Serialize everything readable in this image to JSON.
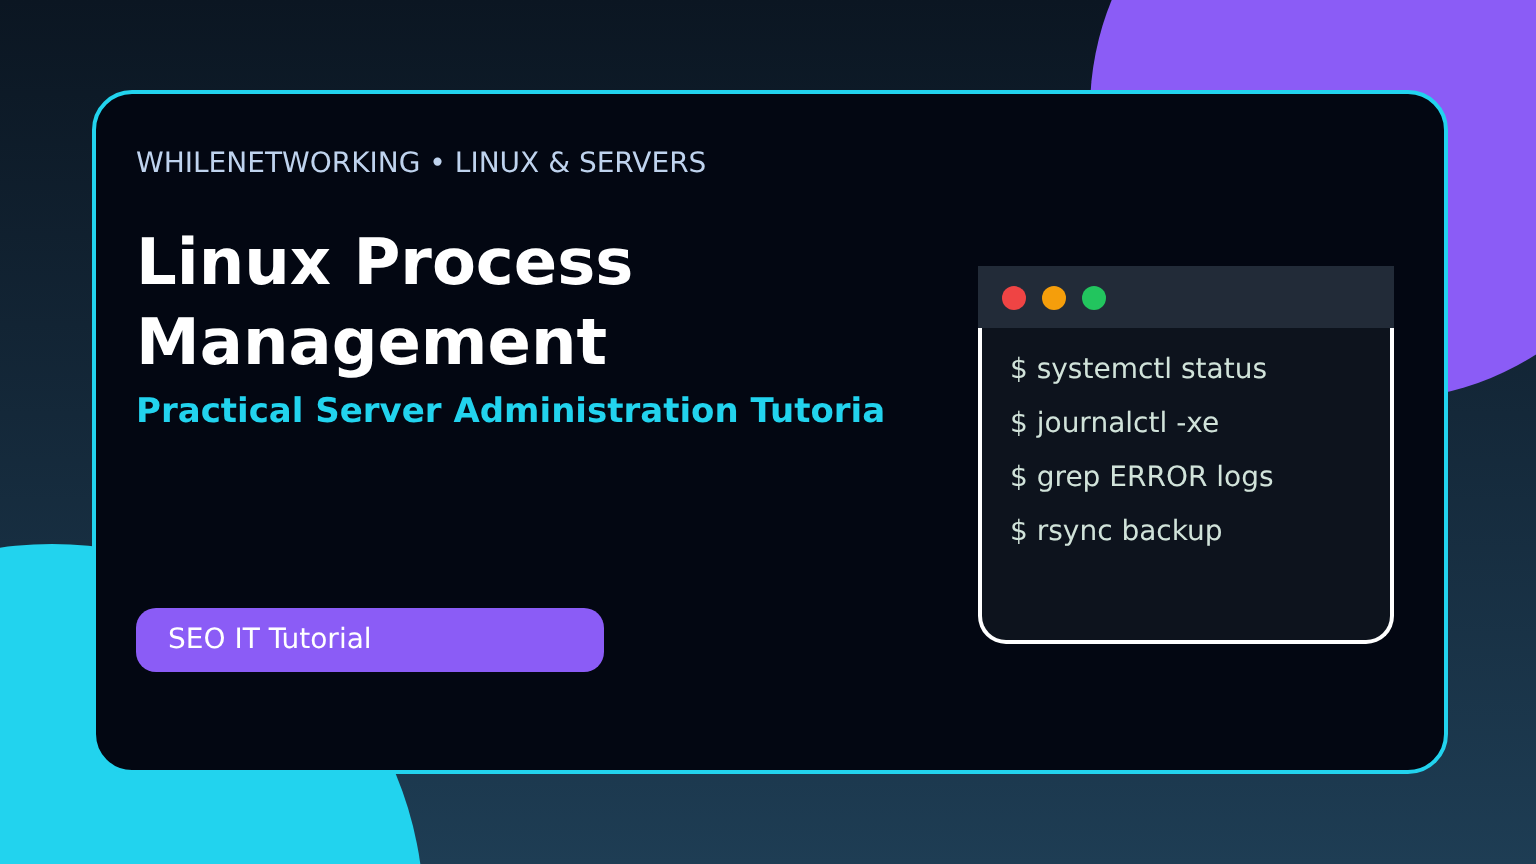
{
  "card": {
    "eyebrow": "WHILENETWORKING • LINUX & SERVERS",
    "title_lines": [
      "Linux Process",
      "Management"
    ],
    "subtitle": "Practical Server Administration Tutoria",
    "badge": "SEO IT Tutorial"
  },
  "terminal": {
    "lines": [
      "$ systemctl status",
      "$ journalctl -xe",
      "$ grep ERROR logs",
      "$ rsync backup"
    ]
  }
}
